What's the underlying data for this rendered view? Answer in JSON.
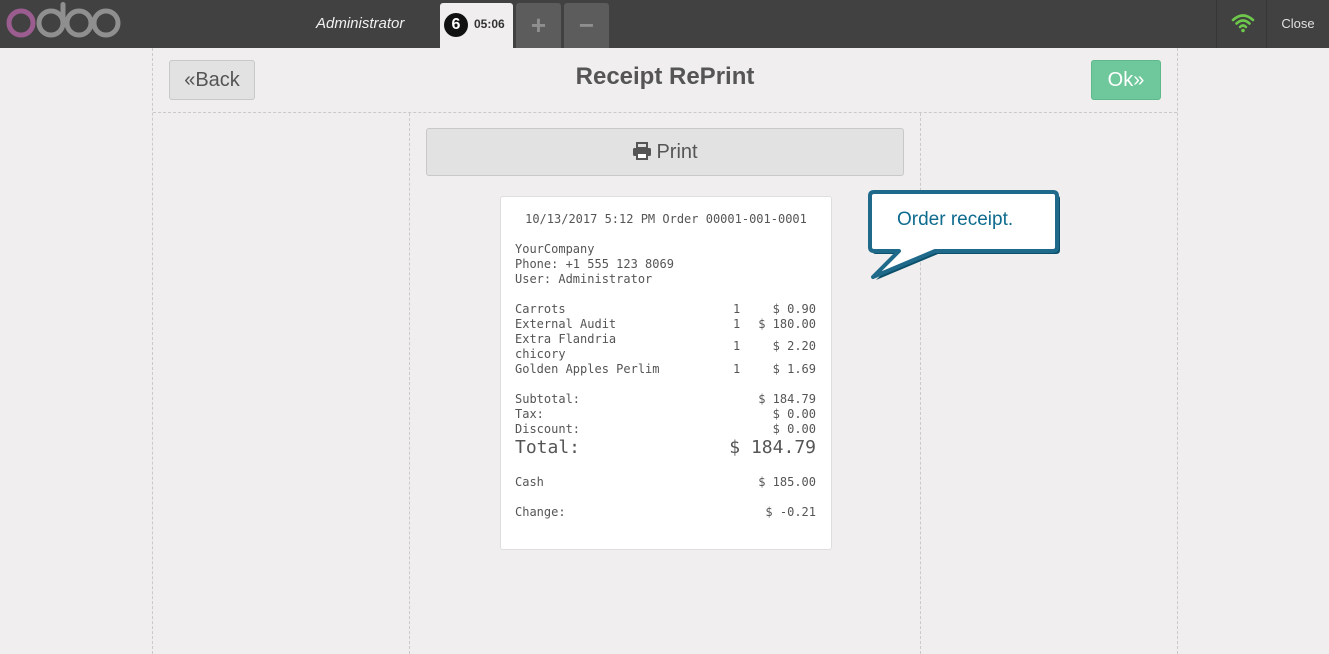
{
  "topbar": {
    "logo_text": "odoo",
    "cashier": "Administrator",
    "order": {
      "sequence": "6",
      "time": "05:06"
    },
    "add_order_symbol": "+",
    "remove_order_symbol": "−",
    "wifi_icon": "wifi-icon",
    "close_label": "Close"
  },
  "screen": {
    "title": "Receipt RePrint",
    "back_label": "Back",
    "ok_label": "Ok",
    "print_label": "Print"
  },
  "receipt": {
    "header": "10/13/2017 5:12 PM Order 00001-001-0001",
    "company": "YourCompany",
    "phone": "Phone: +1 555 123 8069",
    "user": "User: Administrator",
    "lines": [
      {
        "product": "Carrots",
        "qty": "1",
        "price": "$ 0.90"
      },
      {
        "product": "External Audit",
        "qty": "1",
        "price": "$ 180.00"
      },
      {
        "product": "Extra Flandria",
        "product2": "chicory",
        "qty": "1",
        "price": "$ 2.20"
      },
      {
        "product": "Golden Apples Perlim",
        "qty": "1",
        "price": "$ 1.69"
      }
    ],
    "subtotal_label": "Subtotal:",
    "subtotal": "$ 184.79",
    "tax_label": "Tax:",
    "tax": "$ 0.00",
    "discount_label": "Discount:",
    "discount": "$ 0.00",
    "total_label": "Total:",
    "total": "$ 184.79",
    "payment_label": "Cash",
    "payment": "$ 185.00",
    "change_label": "Change:",
    "change": "$ -0.21"
  },
  "callout": {
    "text": "Order receipt."
  },
  "colors": {
    "accent": "#6ec89b",
    "brand": "#875a7b",
    "callout": "#0e6b8e",
    "topbar": "#414141"
  }
}
